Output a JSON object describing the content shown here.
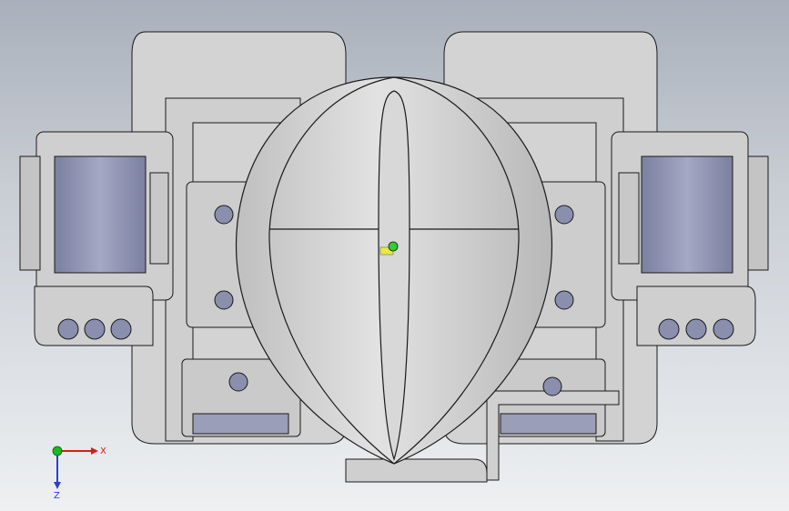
{
  "view": {
    "background_top": "#a9b0bb",
    "background_bottom": "#eef0f2",
    "model_color": "#d3d3d3",
    "edge_color": "#1a1a1a",
    "servo_color": "#8e92b0"
  },
  "triad": {
    "x_label": "X",
    "z_label": "Z",
    "x_color": "#d0201a",
    "y_color": "#1db81d",
    "z_color": "#2a3fd0"
  },
  "origin_marker": {
    "icon": "origin-marker-icon",
    "color": "#33cc33"
  }
}
